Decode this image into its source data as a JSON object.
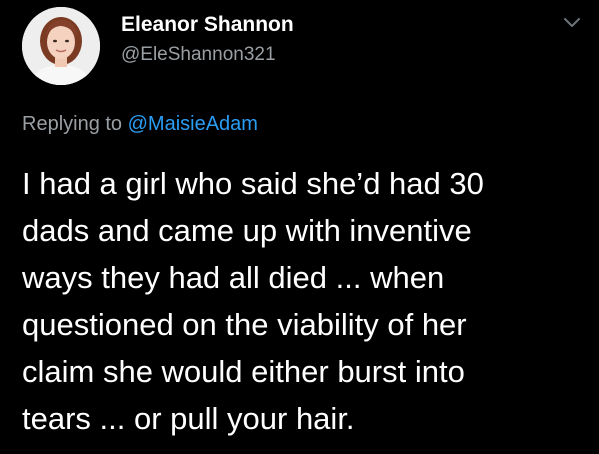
{
  "author": {
    "display_name": "Eleanor Shannon",
    "handle": "@EleShannon321"
  },
  "reply": {
    "prefix": "Replying to ",
    "mention": "@MaisieAdam"
  },
  "tweet": {
    "lines": [
      "I had a girl who said she’d had 30",
      "dads and came up with inventive",
      "ways they had all died ... when",
      "questioned on the viability of her",
      "claim she would either burst into",
      "tears ... or pull your hair."
    ]
  },
  "icons": {
    "menu": "chevron-down-icon",
    "avatar": "profile-photo"
  },
  "colors": {
    "background": "#000000",
    "primary_text": "#ffffff",
    "secondary_text": "#9a9fa4",
    "link": "#2a9df4"
  }
}
